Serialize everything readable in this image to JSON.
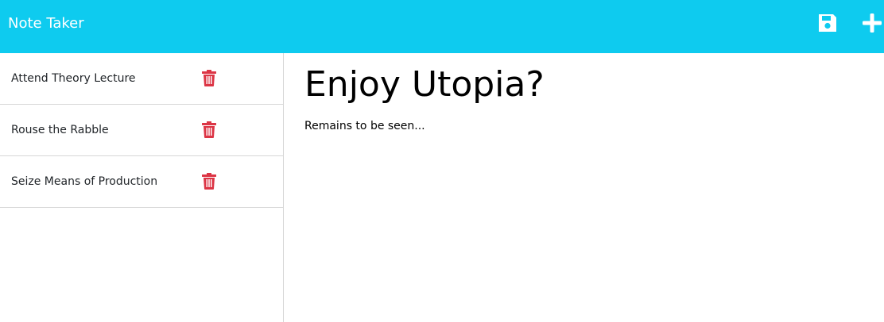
{
  "app": {
    "title": "Note Taker",
    "accent_color": "#0ecbef",
    "delete_color": "#dc3545"
  },
  "toolbar": {
    "save_icon": "save-icon",
    "new_icon": "plus-icon"
  },
  "notes": [
    {
      "title": "Attend Theory Lecture",
      "icon": "trash-icon"
    },
    {
      "title": "Rouse the Rabble",
      "icon": "trash-icon"
    },
    {
      "title": "Seize Means of Production",
      "icon": "trash-icon"
    }
  ],
  "active_note": {
    "title": "Enjoy Utopia?",
    "text": "Remains to be seen..."
  }
}
